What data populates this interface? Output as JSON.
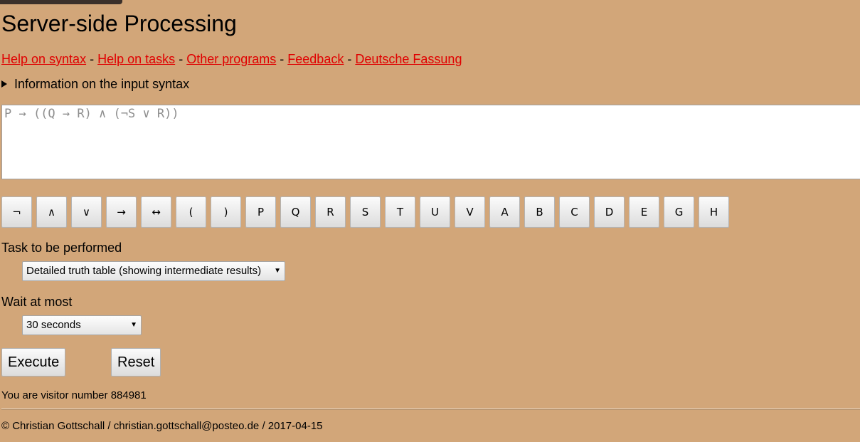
{
  "title": "Server-side Processing",
  "links": [
    {
      "label": "Help on syntax"
    },
    {
      "label": "Help on tasks"
    },
    {
      "label": "Other programs"
    },
    {
      "label": "Feedback"
    },
    {
      "label": "Deutsche Fassung"
    }
  ],
  "link_separator": "-",
  "syntax_info": "Information on the input syntax",
  "formula_input": {
    "value": "",
    "placeholder": "P → ((Q → R) ∧ (¬S ∨ R))"
  },
  "keypad": [
    "¬",
    "∧",
    "∨",
    "→",
    "↔",
    "(",
    ")",
    "P",
    "Q",
    "R",
    "S",
    "T",
    "U",
    "V",
    "A",
    "B",
    "C",
    "D",
    "E",
    "G",
    "H"
  ],
  "task": {
    "label": "Task to be performed",
    "selected": "Detailed truth table (showing intermediate results)"
  },
  "wait": {
    "label": "Wait at most",
    "selected": "30 seconds"
  },
  "buttons": {
    "execute": "Execute",
    "reset": "Reset"
  },
  "visitor_text": "You are visitor number 884981",
  "footer": "© Christian Gottschall / christian.gottschall@posteo.de / 2017-04-15"
}
